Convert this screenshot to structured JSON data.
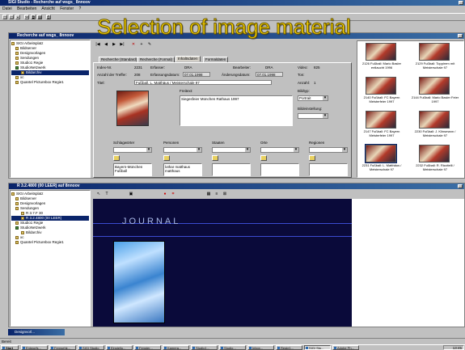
{
  "overlay_title": "Selection of image material",
  "app": {
    "title": "SIGI Studio - Recherche auf wsgs_ 8nnoov",
    "menu": [
      "Datei",
      "Bearbeiten",
      "Ansicht",
      "Fenster",
      "?"
    ]
  },
  "top_window": {
    "title": "Recherche auf wsgs_ 8nnoov",
    "tree": [
      "SIGI Arbeitsplatz",
      "Bildserver",
      "Designvorlagen",
      "Sendungen",
      "Studio1 Regie",
      "StudioNetzwerk",
      "Bildarchiv",
      "xc",
      "Quantel Picturebox Regie1"
    ],
    "tabs": [
      "Recherche (Standard)",
      "Recherche (Formal)",
      "Inhaltsdaten",
      "Formaldaten"
    ],
    "labels": {
      "index_nr": "Index-Nr.",
      "index_val": "2231",
      "erfasser": "Erfasser:",
      "erfasser_val": "DRA",
      "bearbeiter": "Bearbeiter:",
      "bearbeiter_val": "DRA",
      "video": "Video:",
      "video_val": "825",
      "anzahl_treffer": "Anzahl der Treffer:",
      "anzahl_treffer_val": "208",
      "erfassungsdatum": "Erfassungsdatum:",
      "erfassungsdatum_val": "07.01.1998",
      "aenderungsdatum": "Änderungsdatum:",
      "aenderungsdatum_val": "07.01.1998",
      "ton": "Ton:",
      "titel": "Titel:",
      "titel_val": "Fußball, L. Matthäus / Meisterschale 97",
      "anzahl": "Anzahl:",
      "anzahl_val": "1",
      "freitext": "Freitext:",
      "freitext_val": "Siegesfeier München Rathaus 1997",
      "bildtyp": "Bildtyp:",
      "bildtyp_val": "Portrait",
      "bildeinstellung": "Bildeinstellung:",
      "schlagwoerter": "Schlagwörter",
      "schlagwoerter_val": "Bayern-München Fußball",
      "personen": "Personen",
      "personen_val": "lothar matthaus matthaus",
      "staaten": "Staaten",
      "orte": "Orte",
      "regionen": "Regionen"
    },
    "thumbnails": [
      {
        "caption": "2126 Fußball: Mario Basler entlaucht 1996"
      },
      {
        "caption": "2129 Fußball: Toppirem mit Meisterschale 97"
      },
      {
        "caption": "2140 Fußball: FC Bayern Meisterfeier 1997"
      },
      {
        "caption": "2144 Fußball: Mario Basler Feier 1997"
      },
      {
        "caption": "2147 Fußball: FC Bayern Meisterfeier 1997"
      },
      {
        "caption": "2230 Fußball: J. Klinsmann / Meisterschale 97"
      },
      {
        "caption": "2231 Fußball: L. Matthäus / Meisterschale 97"
      },
      {
        "caption": "2232 Fußball: R. Rizzitelli / Meisterschale 97"
      }
    ]
  },
  "bottom_window": {
    "title": "R 3.2.4800 (00 LEER) auf 8nnoov",
    "tree": [
      "SIGI Arbeitsplatz",
      "Bildserver",
      "Designvorlagen",
      "Sendungen",
      "R 3.7.F 30",
      "R 3.2.4800 (00 LEER)",
      "Studio1 Regie",
      "StudioNetzwerk",
      "Bildarchiv",
      "xc",
      "Quantel Picturebox Regie1"
    ],
    "canvas_text": "JOURNAL"
  },
  "minimized": {
    "label": "Designvorl..."
  },
  "status": {
    "left": "Bereit",
    "clock": "13:45"
  },
  "taskbar": {
    "start": "Start",
    "items": [
      "Entwurfs...",
      "Fernsehk...",
      "SIGI Studio",
      "Einstellu...",
      "Fenster...",
      "Kamera...",
      "Studio1...",
      "Studio...",
      "Inbox...",
      "Regie1...",
      "SIGI Stu...",
      "Adobe Ph..."
    ]
  },
  "colors": {
    "accent": "#0a246a",
    "overlay_text": "#ffd700",
    "journal_bg": "#0a0a3a"
  }
}
